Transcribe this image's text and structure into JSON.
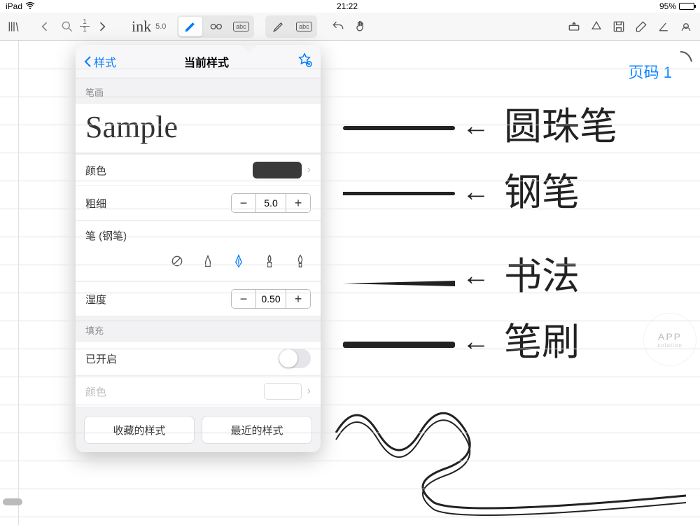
{
  "status": {
    "device": "iPad",
    "time": "21:22",
    "battery_pct": "95%"
  },
  "toolbar": {
    "ink_label": "ink",
    "ink_size": "5.0",
    "page_num": "1",
    "page_total": "1",
    "abc1": "abc",
    "abc2": "abc"
  },
  "canvas": {
    "page_label": "页码 1",
    "labels": {
      "ballpoint": "圆珠笔",
      "fountain": "钢笔",
      "calligraphy": "书法",
      "brush": "笔刷"
    },
    "watermark": "APP",
    "watermark_sub": "solution"
  },
  "popover": {
    "back": "样式",
    "title": "当前样式",
    "section_stroke": "笔画",
    "sample": "Sample",
    "color_label": "颜色",
    "thickness_label": "粗细",
    "thickness_value": "5.0",
    "pen_label": "笔 (钢笔)",
    "wetness_label": "湿度",
    "wetness_value": "0.50",
    "section_fill": "填充",
    "enabled_label": "已开启",
    "fill_color_label": "颜色",
    "fav_btn": "收藏的样式",
    "recent_btn": "最近的样式"
  }
}
